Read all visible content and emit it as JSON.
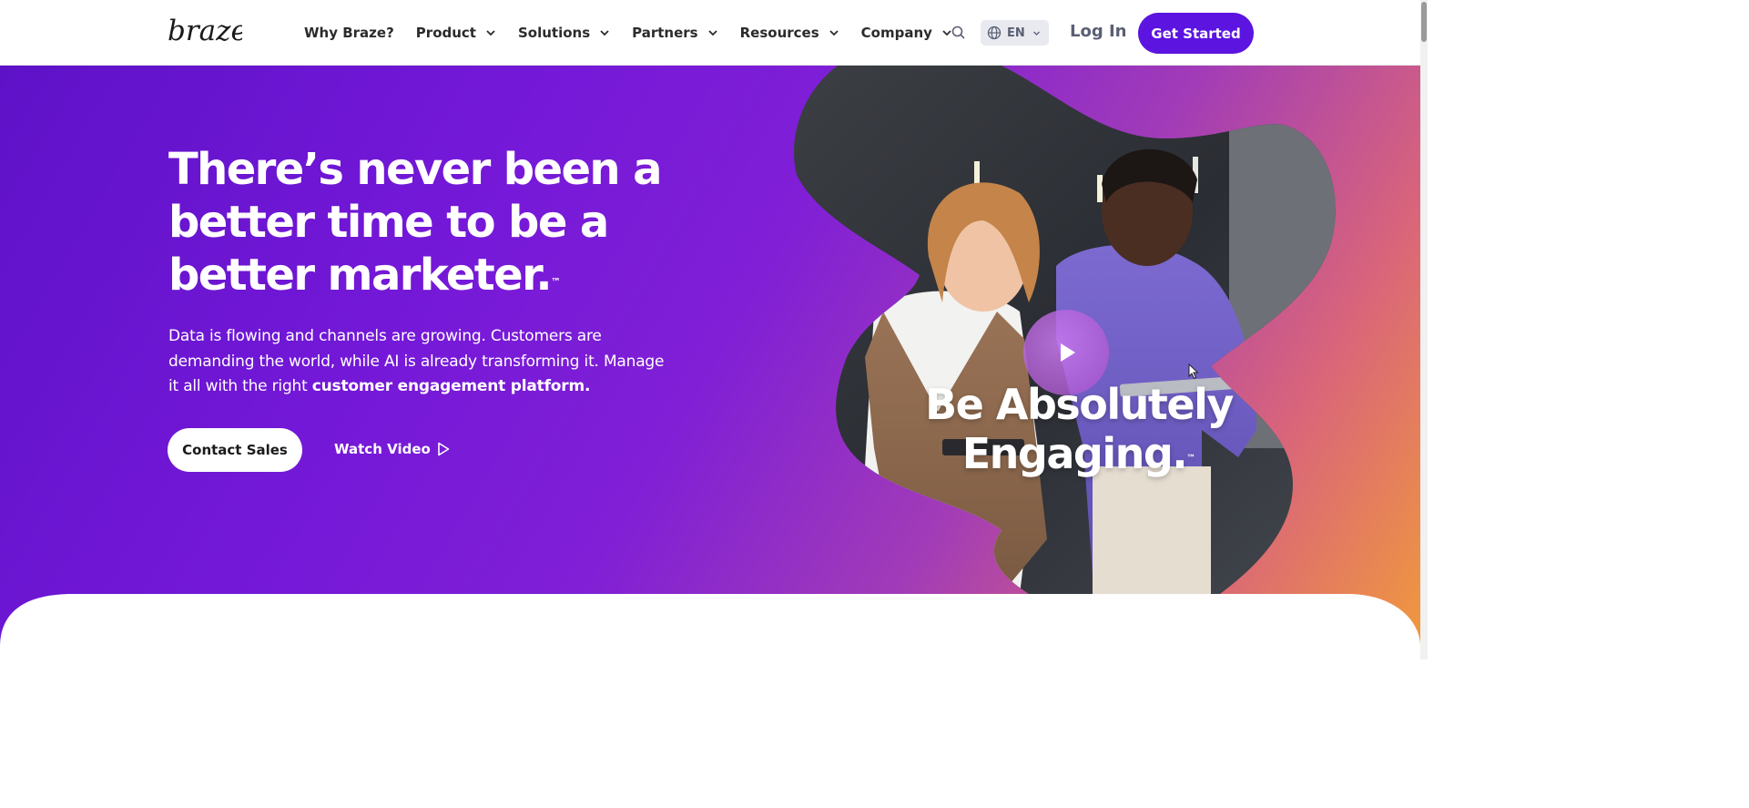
{
  "nav": {
    "logo_text": "braze",
    "items": [
      {
        "label": "Why Braze?",
        "has_dropdown": false
      },
      {
        "label": "Product",
        "has_dropdown": true
      },
      {
        "label": "Solutions",
        "has_dropdown": true
      },
      {
        "label": "Partners",
        "has_dropdown": true
      },
      {
        "label": "Resources",
        "has_dropdown": true
      },
      {
        "label": "Company",
        "has_dropdown": true
      }
    ],
    "language": "EN",
    "login_label": "Log In",
    "cta_label": "Get Started"
  },
  "hero": {
    "headline_line1": "There’s never been a",
    "headline_line2": "better time to be a",
    "headline_line3": "better marketer.",
    "headline_tm": "™",
    "subtext_plain": "Data is flowing and channels are growing. Customers are demanding the world, while AI is already transforming it. Manage it all with the right ",
    "subtext_bold": "customer engagement platform.",
    "contact_label": "Contact Sales",
    "watch_label": "Watch Video",
    "video_line1": "Be Absolutely",
    "video_line2": "Engaging.",
    "video_tm": "™"
  },
  "colors": {
    "brand_purple": "#5c14e0",
    "hero_gradient_start": "#5e12c8",
    "hero_gradient_end": "#f19a3c"
  }
}
